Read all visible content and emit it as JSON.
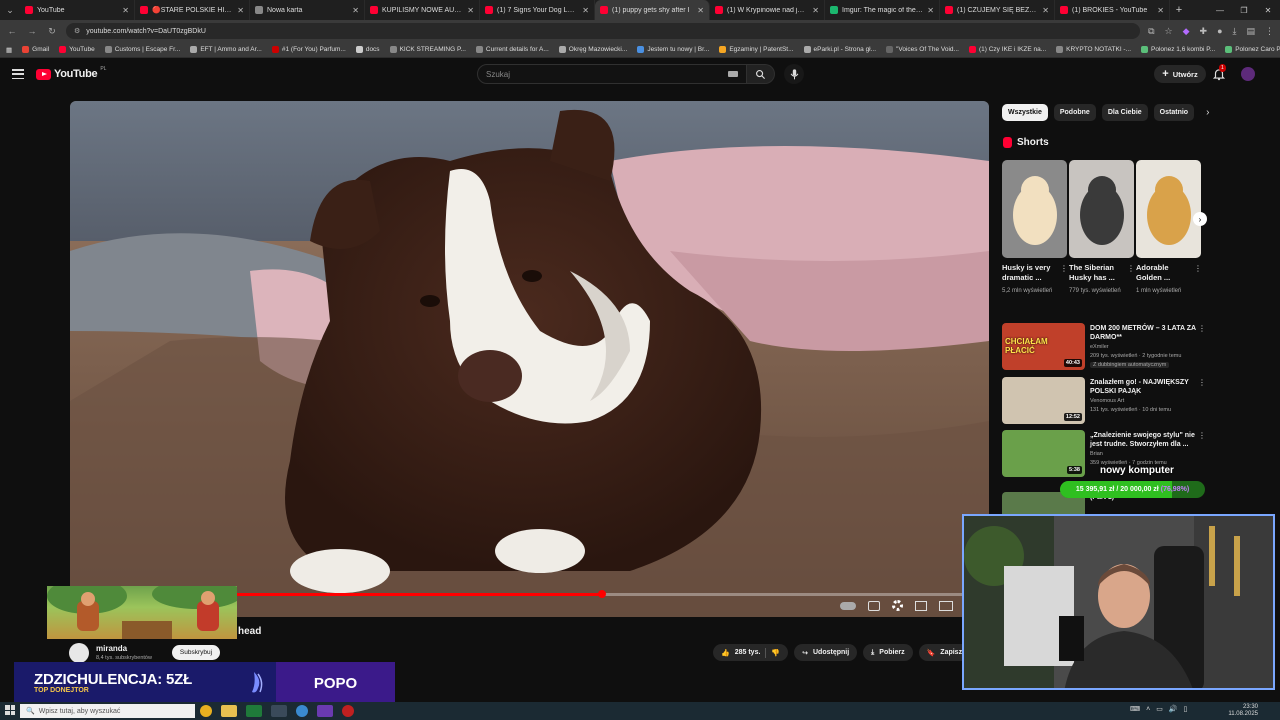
{
  "browser": {
    "tabs": [
      {
        "label": "YouTube",
        "color": "#ff0033",
        "active": false
      },
      {
        "label": "🔴STARE POLSKIE HITY W RE",
        "color": "#ff0033",
        "active": false
      },
      {
        "label": "Nowa karta",
        "color": "#888888",
        "active": false
      },
      {
        "label": "KUPILIŚMY NOWE AUTO! - Yo",
        "color": "#ff0033",
        "active": false
      },
      {
        "label": "(1) 7 Signs Your Dog Loves Yo",
        "color": "#ff0033",
        "active": false
      },
      {
        "label": "(1) puppy gets shy after I",
        "color": "#ff0033",
        "active": true
      },
      {
        "label": "(1) W Krypinowie nad jezior",
        "color": "#ff0033",
        "active": false
      },
      {
        "label": "Imgur: The magic of the Inter",
        "color": "#1bb76e",
        "active": false
      },
      {
        "label": "(1) CZUJEMY SIĘ BEZRADNI",
        "color": "#ff0033",
        "active": false
      },
      {
        "label": "(1) BROKIES - YouTube",
        "color": "#ff0033",
        "active": false
      }
    ],
    "url": "youtube.com/watch?v=DaUT0zgBDkU",
    "bookmarks": [
      {
        "label": "Gmail",
        "color": "#ea4335"
      },
      {
        "label": "YouTube",
        "color": "#ff0033"
      },
      {
        "label": "Customs | Escape Fr...",
        "color": "#888888"
      },
      {
        "label": "EFT | Ammo and Ar...",
        "color": "#aaaaaa"
      },
      {
        "label": "#1 (For You) Parfum...",
        "color": "#cc0000"
      },
      {
        "label": "docs",
        "color": "#cccccc"
      },
      {
        "label": "KICK STREAMING P...",
        "color": "#888888"
      },
      {
        "label": "Current details for A...",
        "color": "#888888"
      },
      {
        "label": "Okręg Mazowiecki...",
        "color": "#aaaaaa"
      },
      {
        "label": "Jestem tu nowy | Br...",
        "color": "#4a90e2"
      },
      {
        "label": "Egzaminy | PatentSt...",
        "color": "#f5a623"
      },
      {
        "label": "eParki.pl - Strona gł...",
        "color": "#aaaaaa"
      },
      {
        "label": "\"Voices Of The Void...",
        "color": "#666666"
      },
      {
        "label": "(1) Czy IKE i IKZE na...",
        "color": "#ff0033"
      },
      {
        "label": "KRYPTO NOTATKI -...",
        "color": "#888888"
      },
      {
        "label": "Polonez 1,6 kombi P...",
        "color": "#5bbf7a"
      },
      {
        "label": "Polonez Caro Plus 1...",
        "color": "#5bbf7a"
      }
    ]
  },
  "youtube": {
    "logo": "YouTube",
    "region": "PL",
    "search_placeholder": "Szukaj",
    "create_label": "Utwórz",
    "notification_count": "1"
  },
  "video": {
    "title_fragment": "head",
    "progress_fraction": 0.58,
    "channel_name": "miranda",
    "channel_subs": "8,4 tys. subskrybentów",
    "subscribe_label": "Subskrybuj",
    "likes": "285 tys.",
    "share_label": "Udostępnij",
    "download_label": "Pobierz",
    "save_label": "Zapisz"
  },
  "sidebar": {
    "chips": [
      "Wszystkie",
      "Podobne",
      "Dla Ciebie",
      "Ostatnio"
    ],
    "shorts_heading": "Shorts",
    "shorts": [
      {
        "title": "Husky is very dramatic ...",
        "views": "5,2 mln wyświetleń"
      },
      {
        "title": "The Siberian Husky has ...",
        "views": "779 tys. wyświetleń"
      },
      {
        "title": "Adorable Golden ...",
        "views": "1 mln wyświetleń"
      }
    ],
    "recommendations": [
      {
        "title": "DOM 200 METRÓW – 3 LATA ZA DARMO**",
        "channel": "eXmiler",
        "meta": "209 tys. wyświetleń · 2 tygodnie temu",
        "extra": "Z dubbingiem automatycznym",
        "duration": "40:43",
        "thumb_text": "CHCIAŁAM PŁACIĆ"
      },
      {
        "title": "Znalazłem go! - NAJWIĘKSZY POLSKI PAJĄK",
        "channel": "Venomous Art",
        "meta": "131 tys. wyświetleń · 10 dni temu",
        "extra": "",
        "duration": "12:52",
        "thumb_text": ""
      },
      {
        "title": "„Znalezienie swojego stylu\" nie jest trudne. Stworzyłem dla ...",
        "channel": "Brian",
        "meta": "359 wyświetleń · 7 godzin temu",
        "extra": "",
        "duration": "5:38",
        "thumb_text": ""
      },
      {
        "title": "(Part 1)",
        "channel": "",
        "meta": "",
        "extra": "",
        "duration": "",
        "thumb_text": ""
      }
    ]
  },
  "stream_overlay": {
    "goal_title": "nowy komputer",
    "goal_text": "15 395,91 zł / 20 000,00 zł",
    "goal_percent": "(76,98%)",
    "goal_fraction": 0.7698,
    "donation_title": "ZDZICHULENCJA: 5ZŁ",
    "donation_subtitle": "TOP DONEJTOR",
    "donor_name": "POPO"
  },
  "taskbar": {
    "search_placeholder": "Wpisz tutaj, aby wyszukać",
    "time": "23:30",
    "date": "11.08.2025"
  }
}
